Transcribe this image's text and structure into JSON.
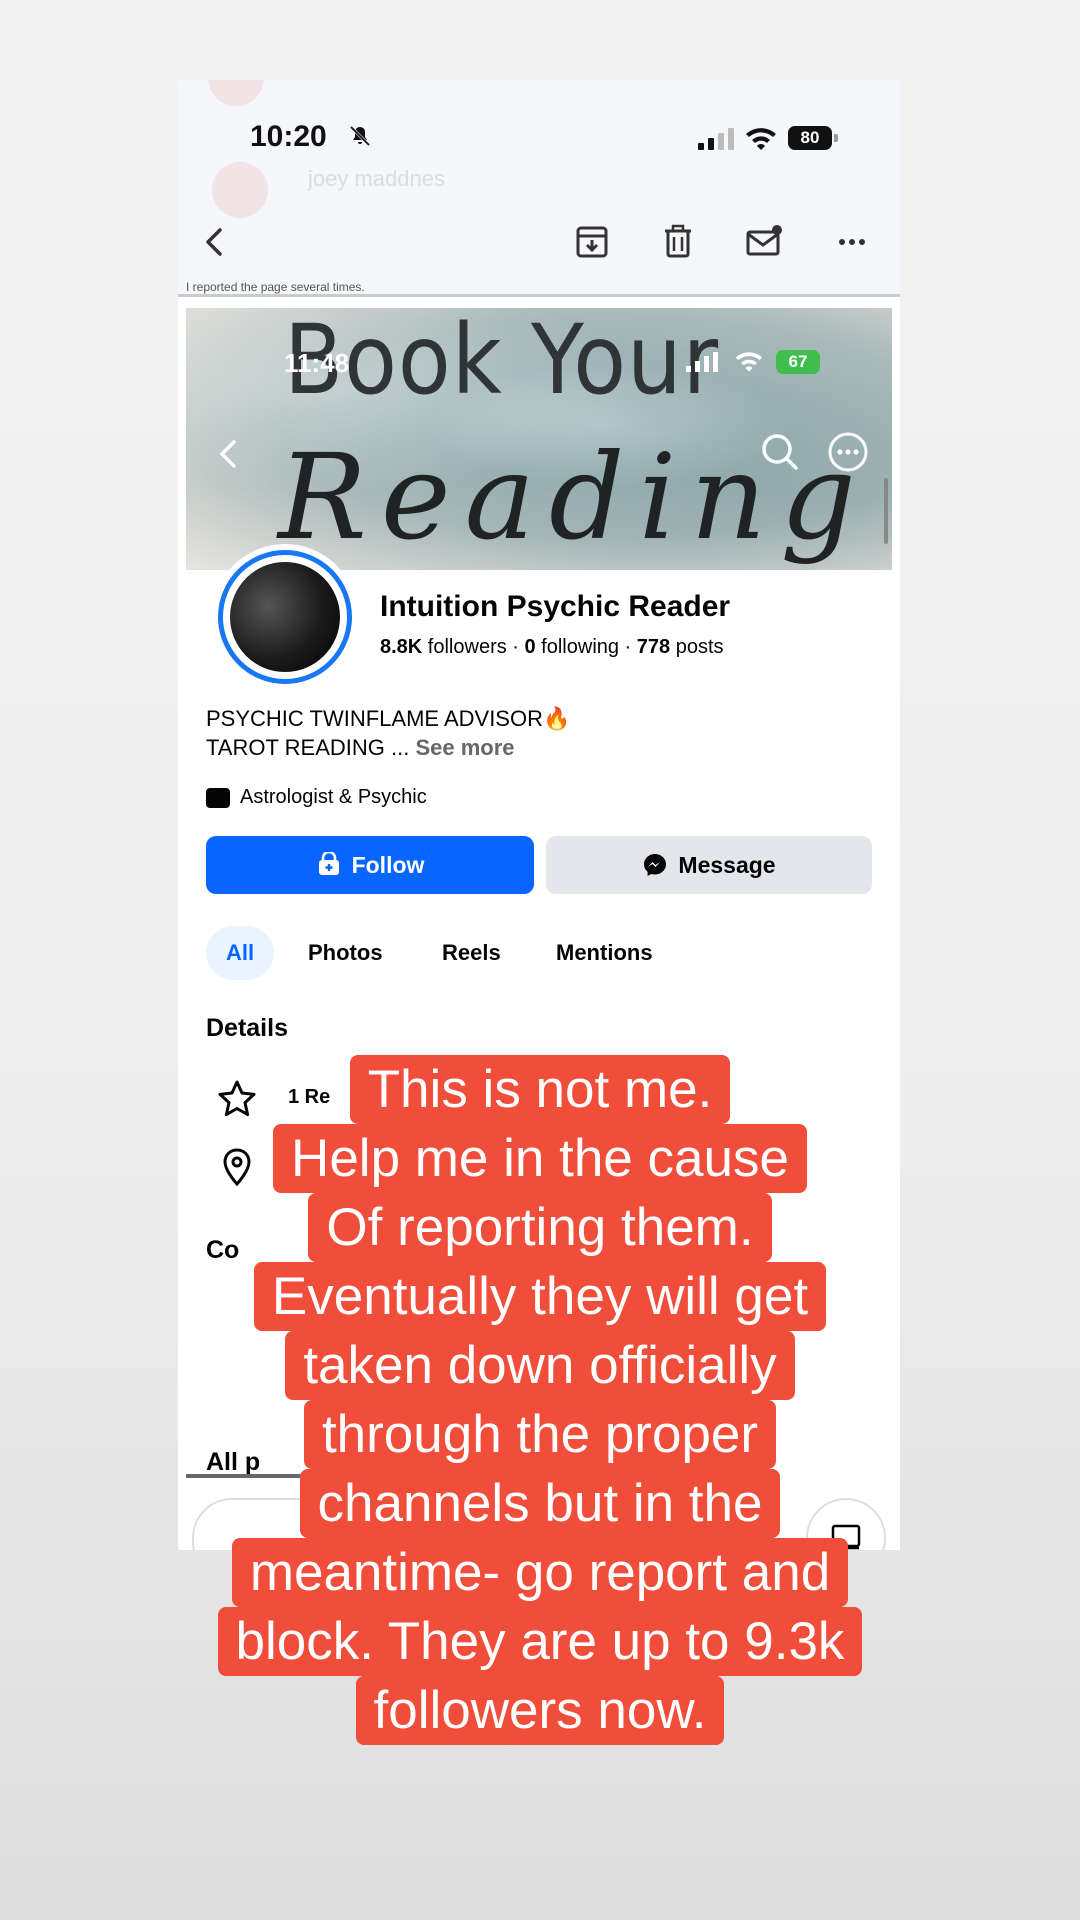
{
  "outer_status": {
    "time": "10:20",
    "battery": "80",
    "bg_text_1": "joey maddnes",
    "bg_text_2": "I reported the page several times."
  },
  "mail_toolbar": {
    "icons": [
      "back-icon",
      "archive-icon",
      "trash-icon",
      "mail-unread-icon",
      "more-icon"
    ]
  },
  "inner_status": {
    "time": "11:48",
    "battery": "67"
  },
  "cover": {
    "title": "Book Your",
    "script": "Reading"
  },
  "profile": {
    "name": "Intuition Psychic Reader",
    "followers_count": "8.8K",
    "followers_label": " followers · ",
    "following_count": "0",
    "following_label": " following · ",
    "posts_count": "778",
    "posts_label": " posts",
    "bio_line1": "PSYCHIC TWINFLAME ADVISOR",
    "bio_emoji": "🔥",
    "bio_line2": "TAROT READING ... ",
    "see_more": "See more",
    "category": "Astrologist & Psychic"
  },
  "actions": {
    "follow": "Follow",
    "message": "Message"
  },
  "tabs": [
    {
      "label": "All",
      "active": true
    },
    {
      "label": "Photos",
      "active": false
    },
    {
      "label": "Reels",
      "active": false
    },
    {
      "label": "Mentions",
      "active": false
    }
  ],
  "sections": {
    "details": "Details",
    "details_row": "1 Re",
    "contact": "Co",
    "all_posts": "All p"
  },
  "caption_lines": [
    "This is not me.",
    "Help me in the cause",
    "Of reporting them.",
    "Eventually they will get",
    "taken down officially",
    "through the proper",
    "channels but in the",
    "meantime- go report and",
    "block. They are up to 9.3k",
    "followers now."
  ],
  "colors": {
    "caption_bg": "#f04e3b",
    "follow_blue": "#0866ff",
    "message_gray": "#e4e6eb"
  }
}
